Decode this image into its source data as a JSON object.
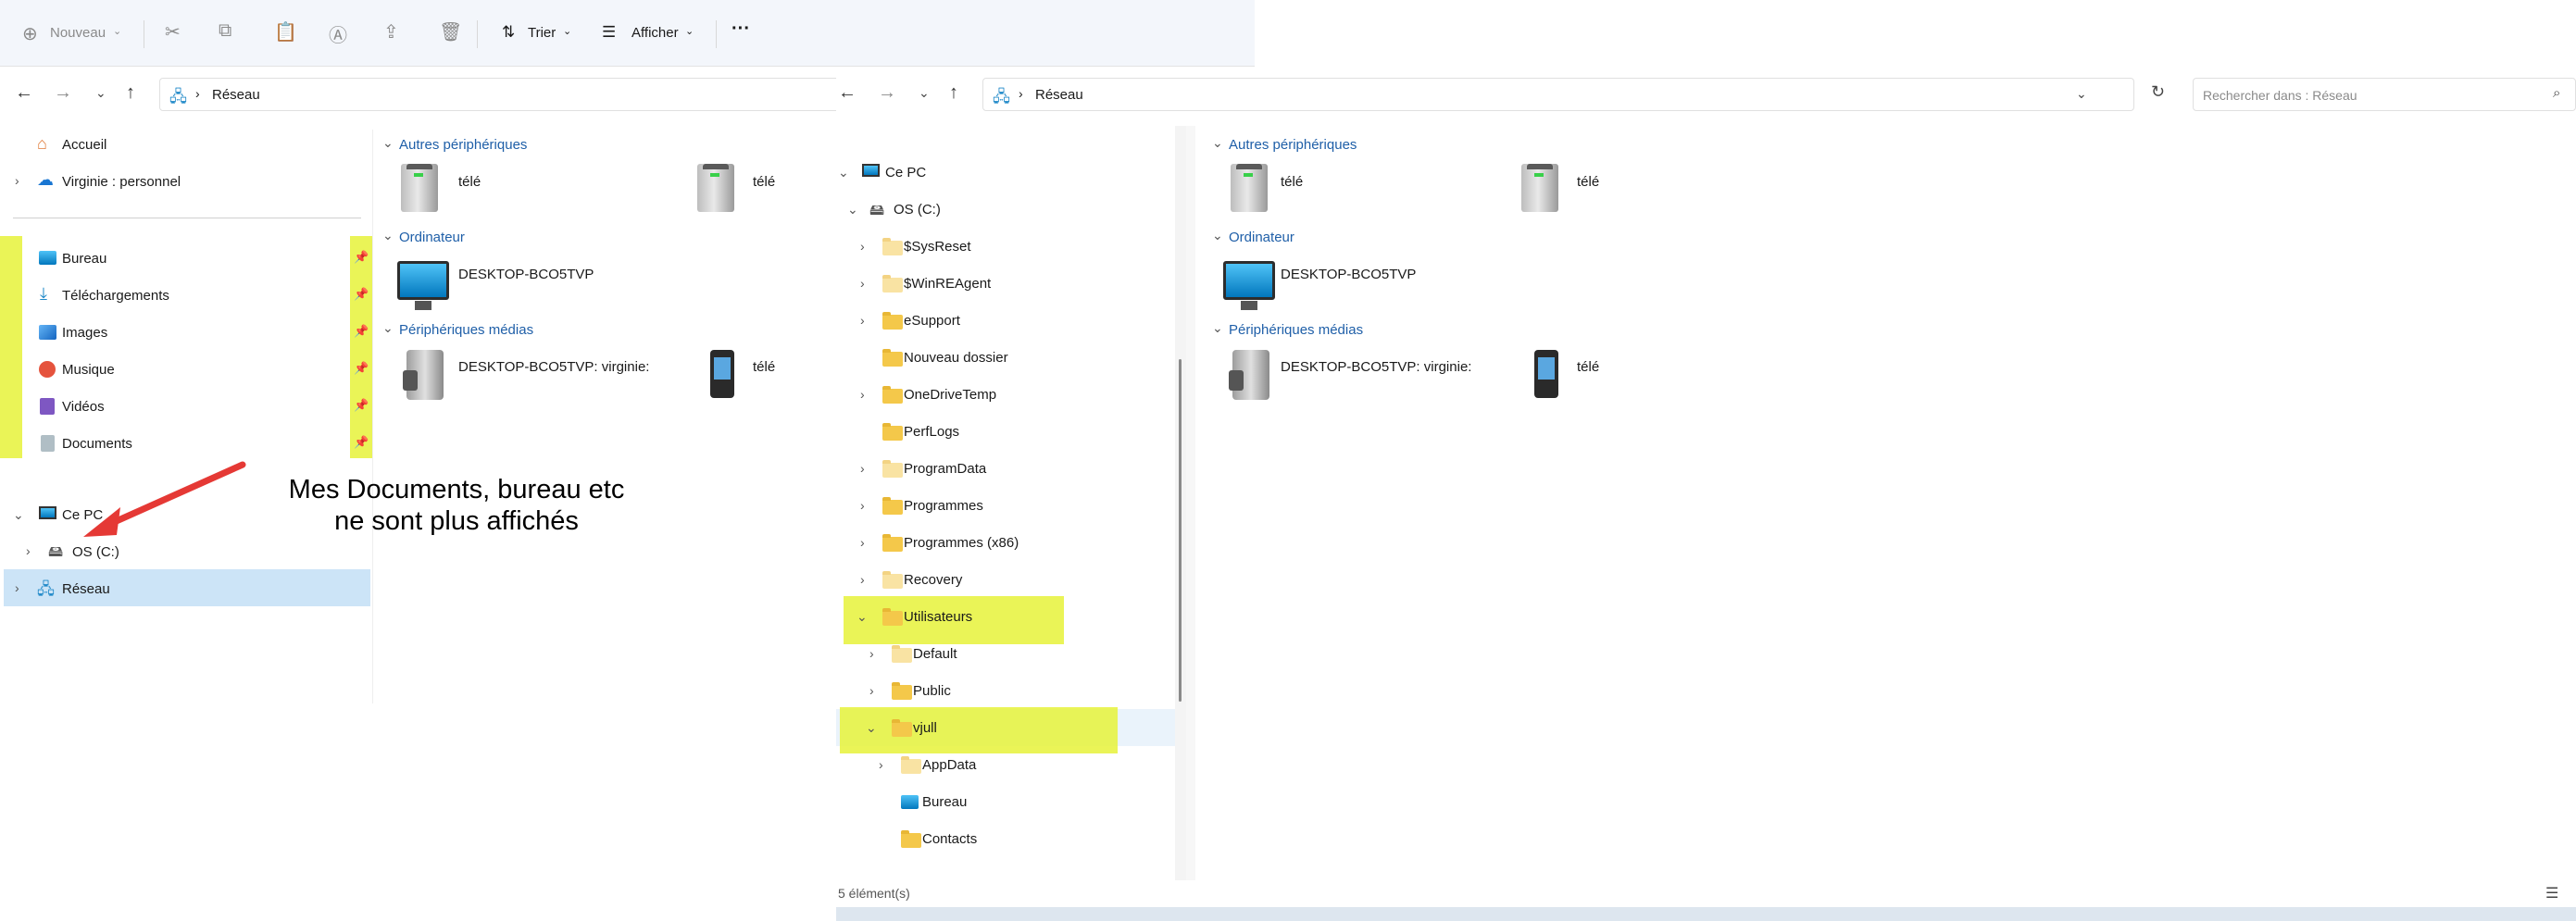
{
  "left": {
    "toolbar": {
      "new_label": "Nouveau",
      "sort_label": "Trier",
      "view_label": "Afficher",
      "more_label": "···"
    },
    "address": {
      "location": "Réseau"
    },
    "nav": {
      "home": "Accueil",
      "onedrive": "Virginie : personnel",
      "quick_access": [
        "Bureau",
        "Téléchargements",
        "Images",
        "Musique",
        "Vidéos",
        "Documents"
      ],
      "this_pc": "Ce PC",
      "drive": "OS (C:)",
      "network": "Réseau"
    },
    "content": {
      "group_other": "Autres périphériques",
      "other_items": [
        "télé",
        "télé"
      ],
      "group_computer": "Ordinateur",
      "computer_item": "DESKTOP-BCO5TVP",
      "group_media": "Périphériques médias",
      "media_items": [
        "DESKTOP-BCO5TVP: virginie:",
        "télé"
      ]
    },
    "annotation": {
      "line1": "Mes Documents, bureau etc",
      "line2": "ne sont plus affichés"
    }
  },
  "right": {
    "address": {
      "location": "Réseau"
    },
    "search": {
      "placeholder": "Rechercher dans : Réseau"
    },
    "tree": {
      "this_pc": "Ce PC",
      "drive": "OS (C:)",
      "folders": [
        "$SysReset",
        "$WinREAgent",
        "eSupport",
        "Nouveau dossier",
        "OneDriveTemp",
        "PerfLogs",
        "ProgramData",
        "Programmes",
        "Programmes (x86)",
        "Recovery",
        "Utilisateurs"
      ],
      "users": [
        "Default",
        "Public",
        "vjull"
      ],
      "vjull_children": [
        "AppData",
        "Bureau",
        "Contacts"
      ]
    },
    "content": {
      "group_other": "Autres périphériques",
      "other_items": [
        "télé",
        "télé"
      ],
      "group_computer": "Ordinateur",
      "computer_item": "DESKTOP-BCO5TVP",
      "group_media": "Périphériques médias",
      "media_items": [
        "DESKTOP-BCO5TVP: virginie:",
        "télé"
      ]
    },
    "status": {
      "count": "5 élément(s)"
    }
  },
  "colors": {
    "highlight": "#e6f23a",
    "selection": "#cce4f7",
    "annotation_arrow": "#e53935",
    "link_blue": "#1f5fa8"
  }
}
